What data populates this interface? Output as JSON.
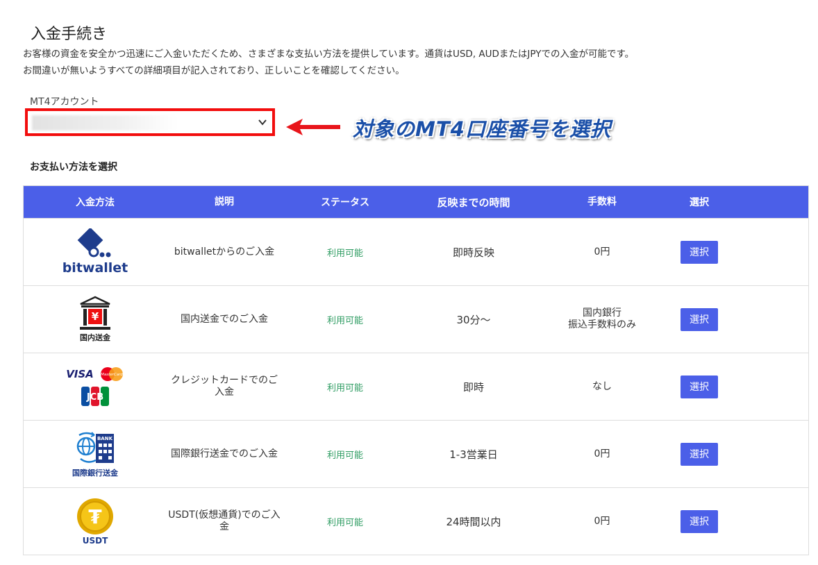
{
  "page": {
    "title": "入金手続き",
    "intro_line1": "お客様の資金を安全かつ迅速にご入金いただくため、さまざまな支払い方法を提供しています。通貨はUSD, AUDまたはJPYでの入金が可能です。",
    "intro_line2": "お間違いが無いようすべての詳細項目が記入されており、正しいことを確認してください。"
  },
  "account": {
    "label": "MT4アカウント",
    "annotation": "対象のMT4口座番号を選択"
  },
  "payment": {
    "section_label": "お支払い方法を選択",
    "headers": [
      "入金方法",
      "説明",
      "ステータス",
      "反映までの時間",
      "手数料",
      "選択"
    ],
    "rows": [
      {
        "logo_text": "bitwallet",
        "description": "bitwalletからのご入金",
        "status": "利用可能",
        "time": "即時反映",
        "fee": "0円",
        "button": "選択"
      },
      {
        "logo_text": "国内送金",
        "logo_glyph": "¥",
        "description": "国内送金でのご入金",
        "status": "利用可能",
        "time": "30分～",
        "fee_line1": "国内銀行",
        "fee_line2": "振込手数料のみ",
        "button": "選択"
      },
      {
        "logo_visa": "VISA",
        "logo_mc": "MasterCard",
        "logo_jcb": "JCB",
        "description": "クレジットカードでのご入金",
        "status": "利用可能",
        "time": "即時",
        "fee": "なし",
        "button": "選択"
      },
      {
        "logo_text": "国際銀行送金",
        "logo_bank": "BANK",
        "description": "国際銀行送金でのご入金",
        "status": "利用可能",
        "time": "1-3営業日",
        "fee": "0円",
        "button": "選択"
      },
      {
        "logo_text": "USDT",
        "logo_glyph": "₮",
        "description": "USDT(仮想通貨)でのご入金",
        "status": "利用可能",
        "time": "24時間以内",
        "fee": "0円",
        "button": "選択"
      }
    ]
  },
  "colors": {
    "header_bg": "#4b5fe8",
    "button_bg": "#4b5fe8",
    "status_green": "#2e9c62",
    "highlight_red": "#f20d0d",
    "bitwallet_blue": "#1e3c8c",
    "annotation_blue": "#1a4fa8"
  }
}
